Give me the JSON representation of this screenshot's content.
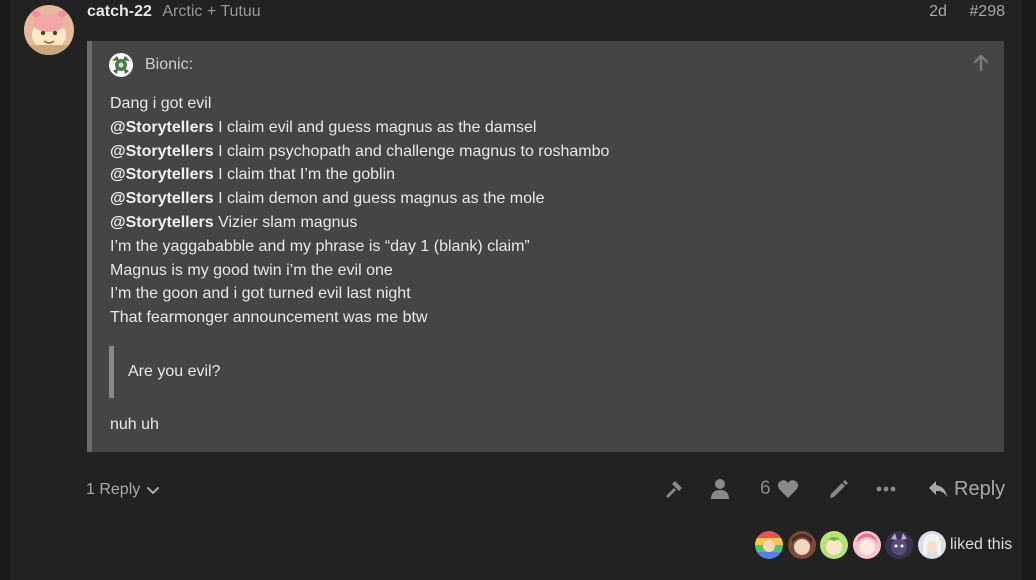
{
  "post": {
    "username": "catch-22",
    "user_title": "Arctic + Tutuu",
    "age": "2d",
    "number": "#298"
  },
  "quote": {
    "author": "Bionic:",
    "lines": [
      {
        "mention": "",
        "text": "Dang i got evil"
      },
      {
        "mention": "@Storytellers",
        "text": " I claim evil and guess magnus as the damsel"
      },
      {
        "mention": "@Storytellers",
        "text": " I claim psychopath and challenge magnus to roshambo"
      },
      {
        "mention": "@Storytellers",
        "text": " I claim that I’m the goblin"
      },
      {
        "mention": "@Storytellers",
        "text": " I claim demon and guess magnus as the mole"
      },
      {
        "mention": "@Storytellers",
        "text": " Vizier slam magnus"
      },
      {
        "mention": "",
        "text": "I’m the yaggababble and my phrase is “day 1 (blank) claim”"
      },
      {
        "mention": "",
        "text": "Magnus is my good twin i’m the evil one"
      },
      {
        "mention": "",
        "text": "I’m the goon and i got turned evil last night"
      },
      {
        "mention": "",
        "text": "That fearmonger announcement was me btw"
      }
    ],
    "nested_quote": "Are you evil?",
    "reply_text": "nuh uh"
  },
  "actions": {
    "replies_label": "1 Reply",
    "like_count": "6",
    "reply_label": "Reply",
    "liked_this": "liked this"
  },
  "icons": {
    "replies": "chevron-down-icon",
    "admin": "wrench-icon",
    "user": "user-icon",
    "like": "heart-icon",
    "edit": "pencil-icon",
    "more": "ellipsis-icon",
    "reply": "reply-arrow-icon",
    "jump": "arrow-up-icon"
  },
  "colors": {
    "background": "#222222",
    "quote_background": "#454545",
    "text": "#e8e8e8",
    "muted": "#a8a8a8"
  }
}
